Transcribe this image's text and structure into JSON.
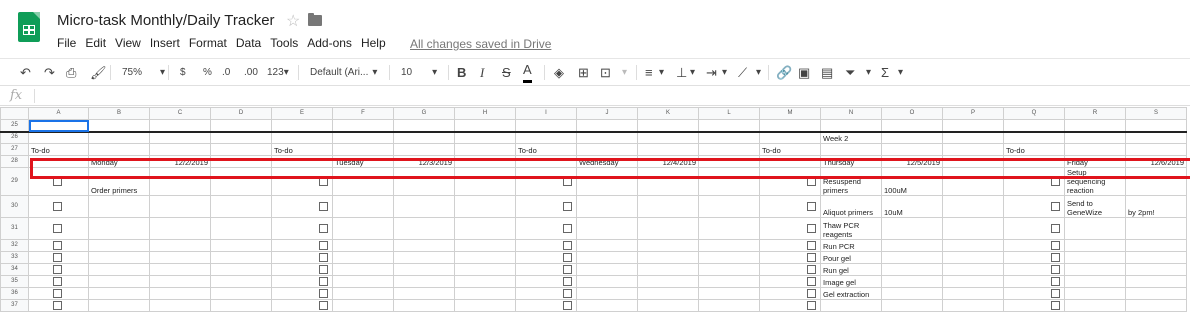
{
  "app": {
    "title": "Micro-task Monthly/Daily Tracker",
    "save_status": "All changes saved in Drive",
    "menu": [
      "File",
      "Edit",
      "View",
      "Insert",
      "Format",
      "Data",
      "Tools",
      "Add-ons",
      "Help"
    ]
  },
  "toolbar": {
    "zoom": "75%",
    "currency": "$",
    "percent": "%",
    "decrease_decimal": ".0",
    "increase_decimal": ".00",
    "more_formats": "123",
    "font": "Default (Ari...",
    "font_size": "10"
  },
  "formula_bar": {
    "fx": "fx",
    "value": ""
  },
  "columns": [
    "A",
    "B",
    "C",
    "D",
    "E",
    "F",
    "G",
    "H",
    "I",
    "J",
    "K",
    "L",
    "M",
    "N",
    "O",
    "P",
    "Q",
    "R",
    "S"
  ],
  "rows": [
    {
      "num": "25",
      "cells": {}
    },
    {
      "num": "26",
      "cells": {
        "N": "Week 2"
      }
    },
    {
      "num": "27",
      "cells": {
        "A": "To-do",
        "E": "To-do",
        "I": "To-do",
        "M": "To-do",
        "Q": "To-do"
      }
    },
    {
      "num": "28",
      "cells": {
        "B": "Monday",
        "C": "12/2/2019",
        "F": "Tuesday",
        "G": "12/3/2019",
        "J": "Wednesday",
        "K": "12/4/2019",
        "N": "Thursday",
        "O": "12/5/2019",
        "R": "Friday",
        "S": "12/6/2019"
      }
    },
    {
      "num": "29",
      "cells": {
        "B": "Order primers",
        "N": "Resuspend primers",
        "O": "100uM",
        "R": "Setup sequencing reaction"
      }
    },
    {
      "num": "30",
      "cells": {
        "N": "Aliquot primers",
        "O": "10uM",
        "R": "Send to GeneWize",
        "S": "by 2pm!"
      }
    },
    {
      "num": "31",
      "cells": {
        "N": "Thaw PCR reagents"
      }
    },
    {
      "num": "32",
      "cells": {
        "N": "Run PCR"
      }
    },
    {
      "num": "33",
      "cells": {
        "N": "Pour gel"
      }
    },
    {
      "num": "34",
      "cells": {
        "N": "Run gel"
      }
    },
    {
      "num": "35",
      "cells": {
        "N": "Image gel"
      }
    },
    {
      "num": "36",
      "cells": {
        "N": "Gel extraction"
      }
    },
    {
      "num": "37",
      "cells": {}
    }
  ]
}
